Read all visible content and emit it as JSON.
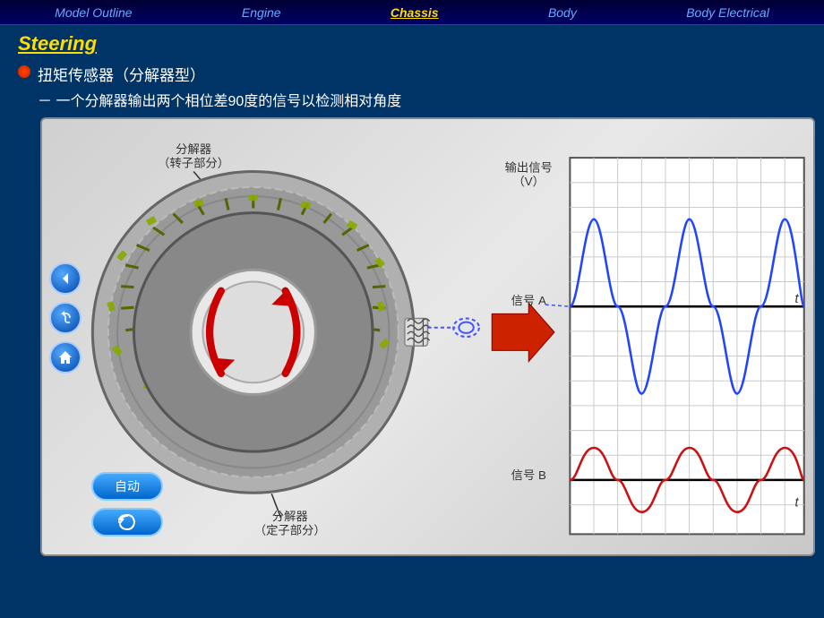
{
  "nav": {
    "items": [
      {
        "label": "Model Outline",
        "active": false
      },
      {
        "label": "Engine",
        "active": false
      },
      {
        "label": "Chassis",
        "active": true
      },
      {
        "label": "Body",
        "active": false
      },
      {
        "label": "Body Electrical",
        "active": false
      }
    ]
  },
  "page": {
    "title": "Steering",
    "bullet_main": "扭矩传感器（分解器型）",
    "bullet_sub": "－ 一个分解器输出两个相位差90度的信号以检测相对角度"
  },
  "diagram": {
    "label_top": "分解器\n（转子部分）",
    "label_bottom": "分解器\n（定子部分）",
    "output_label": "输出信号\n（V）",
    "signal_a_label": "信号 A",
    "signal_b_label": "信号 B",
    "t_label_1": "t",
    "t_label_2": "t"
  },
  "buttons": {
    "auto_label": "自动",
    "nav_icons": [
      "◀",
      "↩",
      "⌂"
    ]
  },
  "colors": {
    "background": "#003366",
    "nav_bg": "#000044",
    "active_tab": "#ffdd00",
    "inactive_tab": "#66aaff",
    "signal_a_color": "#2244ff",
    "signal_b_color": "#cc1111",
    "diagram_bg": "#cccccc"
  }
}
